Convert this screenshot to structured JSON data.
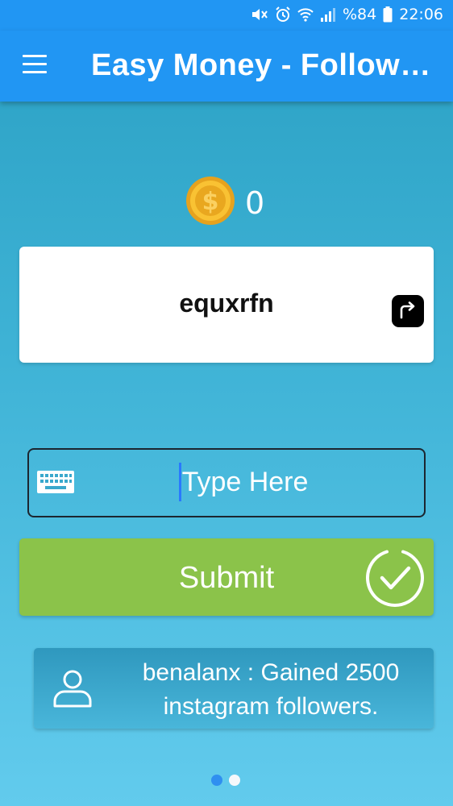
{
  "status_bar": {
    "battery_percent": "%84",
    "time": "22:06",
    "icons": [
      "mute-icon",
      "alarm-icon",
      "wifi-icon",
      "signal-icon",
      "battery-icon"
    ]
  },
  "toolbar": {
    "title": "Easy Money - Followers",
    "menu_icon": "hamburger-menu-icon",
    "background_color": "#2196f3"
  },
  "coins": {
    "icon": "dollar-coin-icon",
    "count": "0"
  },
  "captcha": {
    "text": "equxrfn",
    "refresh_icon": "refresh-captcha-icon"
  },
  "input": {
    "placeholder": "Type Here",
    "value": "",
    "icon": "keyboard-icon"
  },
  "submit": {
    "label": "Submit",
    "icon": "check-circle-icon",
    "color": "#8bc34a"
  },
  "notification": {
    "icon": "user-icon",
    "line1": "benalanx : Gained 2500",
    "line2": "instagram followers."
  },
  "pager": {
    "count": 2,
    "active_index": 0
  }
}
